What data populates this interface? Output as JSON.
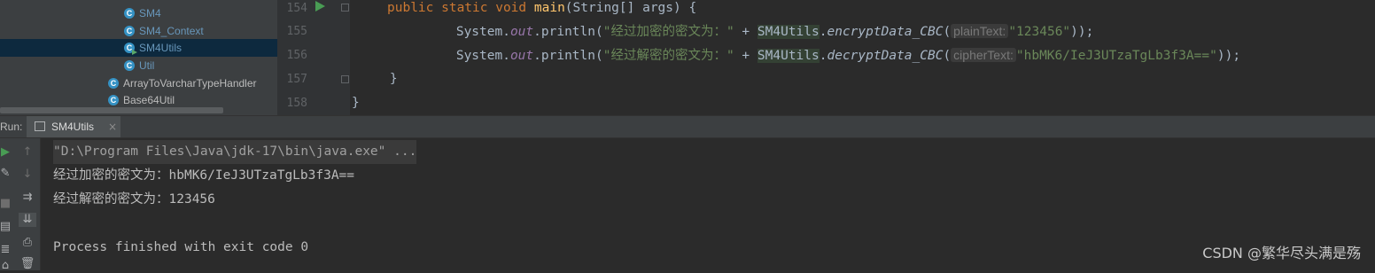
{
  "project_tree": {
    "items": [
      {
        "label": "SM4",
        "kind": "module"
      },
      {
        "label": "SM4_Context",
        "kind": "module"
      },
      {
        "label": "SM4Utils",
        "kind": "module",
        "selected": true
      },
      {
        "label": "Util",
        "kind": "module"
      },
      {
        "label": "ArrayToVarcharTypeHandler",
        "kind": "class"
      },
      {
        "label": "Base64Util",
        "kind": "class"
      }
    ]
  },
  "editor": {
    "line_numbers": [
      "154",
      "155",
      "156",
      "157",
      "158"
    ],
    "line154": {
      "kw1": "public static void ",
      "fn": "main",
      "rest": "(String[] args) {"
    },
    "line155": {
      "indent": "        ",
      "sys": "System.",
      "out": "out",
      "println": ".println(",
      "str": "\"经过加密的密文为：\"",
      "plus": " + ",
      "cls": "SM4Utils",
      "dot": ".",
      "method": "encryptData_CBC",
      "paren": "(",
      "hint": "plainText:",
      "arg": "\"123456\"",
      "end": "));"
    },
    "line156": {
      "indent": "        ",
      "sys": "System.",
      "out": "out",
      "println": ".println(",
      "str": "\"经过解密的密文为：\"",
      "plus": " + ",
      "cls": "SM4Utils",
      "dot": ".",
      "method": "decryptData_CBC",
      "paren": "(",
      "hint": "cipherText:",
      "arg": "\"hbMK6/IeJ3UTzaTgLb3f3A==\"",
      "end": "));"
    },
    "line157": "    }",
    "line158": "}"
  },
  "run_window": {
    "label": "Run:",
    "tab_label": "SM4Utils",
    "tab_close": "×"
  },
  "console": {
    "lines": [
      "\"D:\\Program Files\\Java\\jdk-17\\bin\\java.exe\" ...",
      "经过加密的密文为：hbMK6/IeJ3UTzaTgLb3f3A==",
      "经过解密的密文为：123456",
      "",
      "Process finished with exit code 0"
    ]
  },
  "watermark": "CSDN @繁华尽头满是殇",
  "colors": {
    "keyword": "#cc7832",
    "string": "#6a8759",
    "method": "#ffc66d",
    "field": "#9876aa",
    "module_label": "#6897bb",
    "selection": "#0d293e"
  }
}
